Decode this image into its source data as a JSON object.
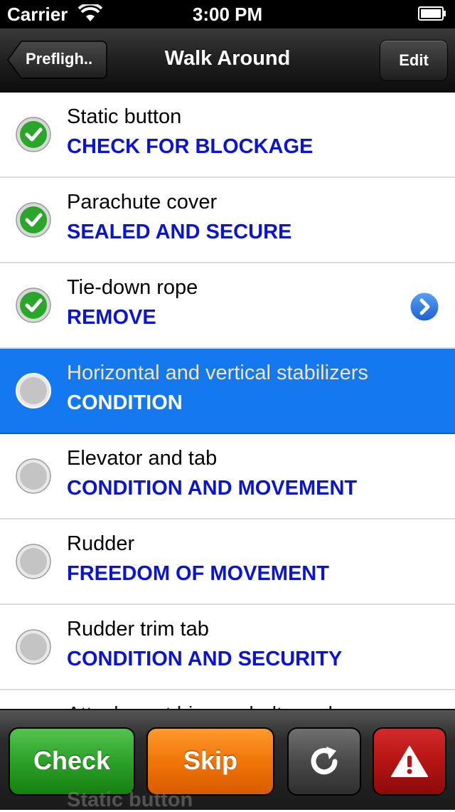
{
  "status_bar": {
    "carrier": "Carrier",
    "time": "3:00 PM"
  },
  "nav": {
    "title": "Walk Around",
    "back_label": "Prefligh..",
    "edit_label": "Edit"
  },
  "items": [
    {
      "title": "Static button",
      "action": "CHECK FOR BLOCKAGE",
      "status": "checked"
    },
    {
      "title": "Parachute cover",
      "action": "SEALED AND SECURE",
      "status": "checked"
    },
    {
      "title": "Tie-down rope",
      "action": "REMOVE",
      "status": "checked"
    },
    {
      "title": "Horizontal and vertical stabilizers",
      "action": "CONDITION",
      "status": "selected"
    },
    {
      "title": "Elevator and tab",
      "action": "CONDITION AND MOVEMENT",
      "status": "unchecked"
    },
    {
      "title": "Rudder",
      "action": "FREEDOM OF MOVEMENT",
      "status": "unchecked"
    },
    {
      "title": "Rudder trim tab",
      "action": "CONDITION AND SECURITY",
      "status": "unchecked"
    },
    {
      "title": "Attachment hinges, bolts and ...",
      "action": "",
      "status": "unchecked"
    }
  ],
  "toolbar": {
    "check_label": "Check",
    "skip_label": "Skip",
    "redo_icon": "redo-icon",
    "alert_icon": "warning-icon"
  },
  "peek_text": "Static button",
  "colors": {
    "selected_row": "#1478ee",
    "action_text": "#0a14d2",
    "check_green": "#2ca12a",
    "skip_orange": "#f07508",
    "alert_red": "#b51414"
  }
}
